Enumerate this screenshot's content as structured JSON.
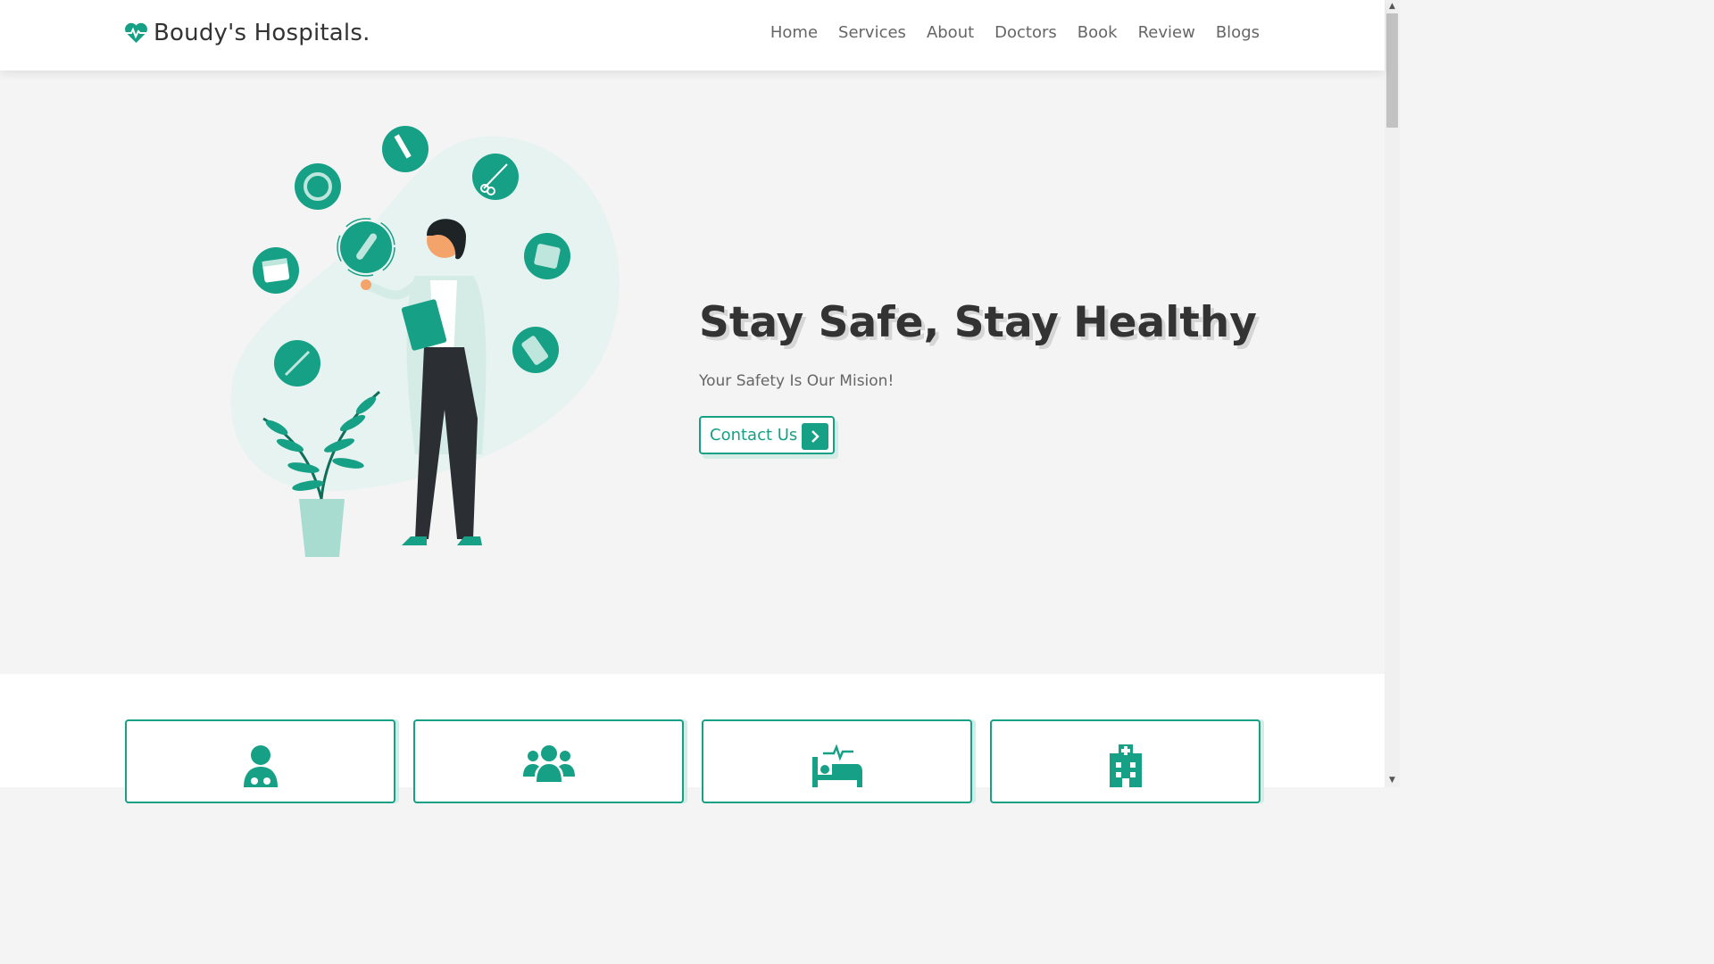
{
  "header": {
    "logo_text": "Boudy's Hospitals.",
    "nav": [
      "Home",
      "Services",
      "About",
      "Doctors",
      "Book",
      "Review",
      "Blogs"
    ]
  },
  "hero": {
    "title": "Stay Safe, Stay Healthy",
    "subtitle": "Your Safety Is Our Mision!",
    "cta_label": "Contact Us"
  },
  "cards": [
    {
      "icon": "user-doctor-icon"
    },
    {
      "icon": "users-icon"
    },
    {
      "icon": "hospital-bed-icon"
    },
    {
      "icon": "hospital-building-icon"
    }
  ],
  "colors": {
    "accent": "#16a085",
    "accent_light": "#d3ece6",
    "background": "#f4f4f4",
    "text_dark": "#333333"
  }
}
